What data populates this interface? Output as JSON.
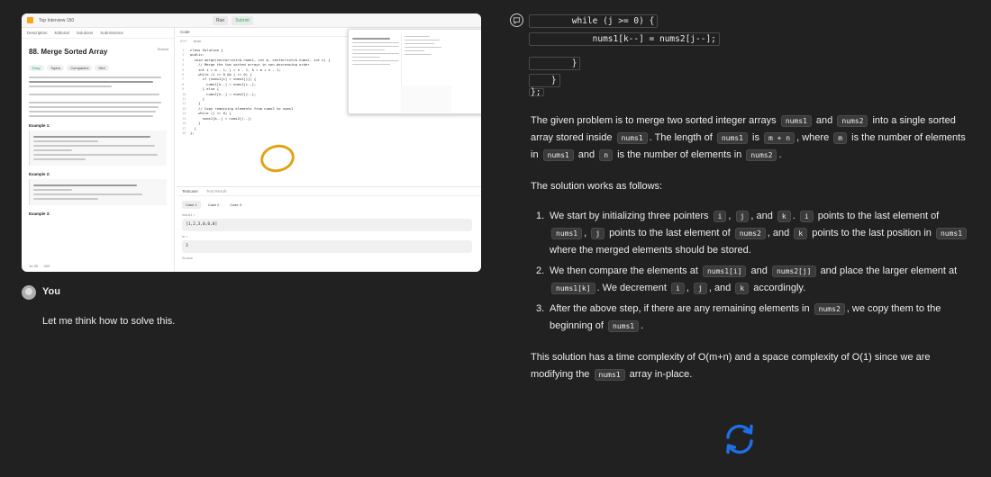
{
  "left": {
    "screenshot": {
      "nav": {
        "list": "Top Interview 150",
        "run": "Run",
        "submit": "Submit"
      },
      "tabs": [
        "Description",
        "Editorial",
        "Solutions",
        "Submissions"
      ],
      "problem_title": "88. Merge Sorted Array",
      "solved": "Solved",
      "tags": [
        "Easy",
        "Topics",
        "Companies",
        "Hint"
      ],
      "example_labels": [
        "Example 1:",
        "Example 2:",
        "Example 3:"
      ],
      "footer": {
        "likes": "14.3K",
        "comments": "493"
      },
      "editor": {
        "header": "Code",
        "lang": "C++",
        "auto": "Auto",
        "lines": [
          "class Solution {",
          "public:",
          "  void merge(vector<int>& nums1, int m, vector<int>& nums2, int n) {",
          "    // Merge the two sorted arrays in non-decreasing order",
          "    int i = m - 1, j = n - 1, k = m + n - 1;",
          "    while (i >= 0 && j >= 0) {",
          "      if (nums1[i] > nums2[j]) {",
          "        nums1[k--] = nums1[i--];",
          "      } else {",
          "        nums1[k--] = nums2[j--];",
          "      }",
          "    }",
          "    // Copy remaining elements from nums2 to nums1",
          "    while (j >= 0) {",
          "      nums1[k--] = nums2[j--];",
          "    }",
          "  }",
          "};"
        ]
      },
      "testcase": {
        "tab": "Testcase",
        "result_tab": "Test Result",
        "cases": [
          "Case 1",
          "Case 2",
          "Case 3"
        ],
        "label1": "nums1 =",
        "value1": "[1,2,3,0,0,0]",
        "label2": "m =",
        "value2": "3",
        "source": "Source"
      }
    },
    "user_name": "You",
    "user_message": "Let me think how to solve this."
  },
  "right": {
    "code_lines": [
      "        while (j >= 0) {",
      "            nums1[k--] = nums2[j--];",
      "        }",
      "    }",
      "};"
    ],
    "para1": {
      "t1": "The given problem is to merge two sorted integer arrays",
      "c1": "nums1",
      "t2": "and",
      "c2": "nums2",
      "t3": "into a single sorted array stored inside",
      "c3": "nums1",
      "t4": ". The length of",
      "c4": "nums1",
      "t5": "is",
      "c5": "m + n",
      "t6": ", where",
      "c6": "m",
      "t7": "is the number of elements in",
      "c7": "nums1",
      "t8": "and",
      "c8": "n",
      "t9": "is the number of elements in",
      "c9": "nums2",
      "t10": "."
    },
    "para2": "The solution works as follows:",
    "steps": [
      {
        "num": "1.",
        "t1": "We start by initializing three pointers",
        "c1": "i",
        "t2": ",",
        "c2": "j",
        "t3": ", and",
        "c3": "k",
        "t4": ".",
        "c4": "i",
        "t5": "points to the last element of",
        "c5": "nums1",
        "t6": ",",
        "c6": "j",
        "t7": "points to the last element of",
        "c7": "nums2",
        "t8": ", and",
        "c8": "k",
        "t9": "points to the last position in",
        "c9": "nums1",
        "t10": "where the merged elements should be stored."
      },
      {
        "num": "2.",
        "t1": "We then compare the elements at",
        "c1": "nums1[i]",
        "t2": "and",
        "c2": "nums2[j]",
        "t3": "and place the larger element at",
        "c3": "nums1[k]",
        "t4": ". We decrement",
        "c4": "i",
        "t5": ",",
        "c5": "j",
        "t6": ", and",
        "c6": "k",
        "t7": "accordingly."
      },
      {
        "num": "3.",
        "t1": "After the above step, if there are any remaining elements in",
        "c1": "nums2",
        "t2": ", we copy them to the beginning of",
        "c2": "nums1",
        "t3": "."
      }
    ],
    "para3": {
      "t1": "This solution has a time complexity of O(m+n) and a space complexity of O(1) since we are modifying the",
      "c1": "nums1",
      "t2": "array in-place."
    },
    "regenerate_icon": "refresh-icon",
    "accent": "#1f6fe5"
  }
}
